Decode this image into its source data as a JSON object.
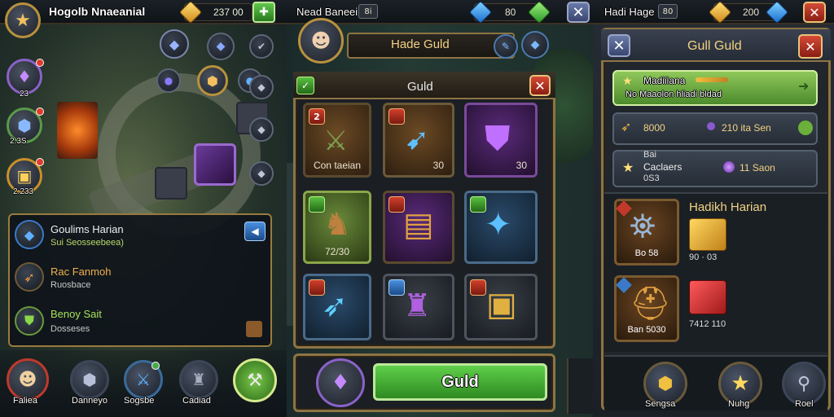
{
  "left_panel": {
    "player_name": "Hogolb Nnaeanial",
    "gold_amount": "237 00",
    "side_orbs": [
      {
        "label": "23",
        "icon": "crystal-icon"
      },
      {
        "label": "2.3S",
        "icon": "dice-icon"
      },
      {
        "label": "2.233",
        "icon": "chest-icon"
      }
    ],
    "list": [
      {
        "title": "Goulims Harian",
        "subtitle": "Sui Seosseebeea)"
      },
      {
        "title": "Rac Fanmoh",
        "subtitle": "Ruosbace"
      },
      {
        "title": "Benoy Sait",
        "subtitle": "Dosseses"
      }
    ],
    "nav": [
      {
        "label": "Faliea"
      },
      {
        "label": "Danneyo"
      },
      {
        "label": "Sogsbe"
      },
      {
        "label": "Cadiad"
      }
    ]
  },
  "mid_panel": {
    "player_name": "Nead Baneei",
    "badge_text": "8i",
    "gem_amount": "80",
    "title": "Hade Guld",
    "dialog_title": "Guld",
    "slots": [
      {
        "label": "Con taeian",
        "badge": "2"
      },
      {
        "label": "30",
        "badge": ""
      },
      {
        "label": "30",
        "badge": ""
      },
      {
        "label": "72/30",
        "badge": ""
      },
      {
        "label": "",
        "badge": ""
      },
      {
        "label": "",
        "badge": ""
      },
      {
        "label": "",
        "badge": ""
      },
      {
        "label": "",
        "badge": ""
      },
      {
        "label": "",
        "badge": ""
      }
    ],
    "action_button": "Guld"
  },
  "right_panel": {
    "player_name": "Hadi Hage",
    "badge_text": "80",
    "gold_amount": "200",
    "title": "Gull Guld",
    "rows": [
      {
        "title": "Madiiiana",
        "subtitle": "No  Maaolon hliadi bldad"
      },
      {
        "left": "8000",
        "right": "210 ita Sen"
      },
      {
        "title": "Bai",
        "mid": "Caclaers",
        "bottom": "0S3",
        "right": "11 Saon"
      }
    ],
    "reward_title": "Hadikh Harian",
    "rewards": [
      {
        "label": "Bo 58"
      },
      {
        "label": "90 · 03"
      },
      {
        "label": "Ban 5030"
      },
      {
        "label": "7412 110"
      }
    ],
    "nav": [
      {
        "label": "Sengsa"
      },
      {
        "label": "Nuhg"
      },
      {
        "label": "Roel"
      }
    ]
  },
  "colors": {
    "gold_border": "#b8913e",
    "action_green": "#4fae3a",
    "close_red": "#c23a28"
  }
}
